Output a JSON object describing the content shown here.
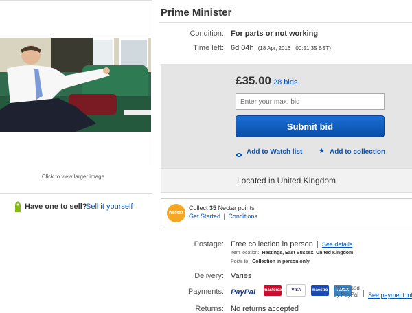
{
  "title": "Prime Minister",
  "image_caption": "Click to view larger image",
  "sell": {
    "question": "Have one to sell?",
    "link": "Sell it yourself"
  },
  "condition": {
    "label": "Condition:",
    "value": "For parts or not working"
  },
  "time_left": {
    "label": "Time left:",
    "value": "6d 04h",
    "date": "(18 Apr, 2016",
    "time": "00:51:35 BST)"
  },
  "bid": {
    "price": "£35.00",
    "bids": "28 bids",
    "placeholder": "Enter your max. bid",
    "submit": "Submit bid",
    "watch": "Add to Watch list",
    "collection": "Add to collection"
  },
  "location": "Located in United Kingdom",
  "nectar": {
    "logo": "nectar",
    "collect_prefix": "Collect",
    "points": "35",
    "collect_suffix": "Nectar points",
    "get_started": "Get Started",
    "separator": "|",
    "conditions": "Conditions"
  },
  "postage": {
    "label": "Postage:",
    "value": "Free collection in person",
    "see_details": "See details",
    "item_location_label": "Item location:",
    "item_location": "Hastings, East Sussex, United Kingdom",
    "posts_to_label": "Posts to:",
    "posts_to": "Collection in person only"
  },
  "delivery": {
    "label": "Delivery:",
    "value": "Varies"
  },
  "payments": {
    "label": "Payments:",
    "paypal": "PayPal",
    "cards": [
      "mastercard",
      "VISA",
      "maestro",
      "AMEX"
    ],
    "processed_line1": "Processed",
    "processed_line2": "by PayPal",
    "see_payment": "See payment inf"
  },
  "returns": {
    "label": "Returns:",
    "value": "No returns accepted"
  },
  "colors": {
    "link": "#0654ba",
    "button": "#0a4ea8",
    "nectar": "#f5a623",
    "sell_icon": "#86b817"
  }
}
